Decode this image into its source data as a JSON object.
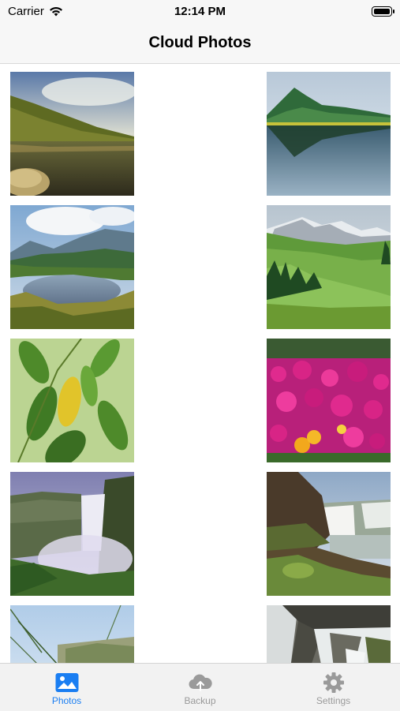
{
  "status_bar": {
    "carrier": "Carrier",
    "time": "12:14 PM"
  },
  "nav": {
    "title": "Cloud Photos"
  },
  "photos": [
    {
      "subject": "mountain lake at sunset"
    },
    {
      "subject": "green mountain reflected in lake"
    },
    {
      "subject": "alpine lake under clouds"
    },
    {
      "subject": "green meadow with snowy peaks"
    },
    {
      "subject": "green leaves with yellow leaf"
    },
    {
      "subject": "pink flowers with yellow blossoms"
    },
    {
      "subject": "misty waterfall"
    },
    {
      "subject": "waterfall with mossy rocks"
    },
    {
      "subject": "grass against sky"
    },
    {
      "subject": "cascading water over rocks"
    }
  ],
  "tabs": [
    {
      "label": "Photos",
      "icon": "photo-icon",
      "active": true
    },
    {
      "label": "Backup",
      "icon": "cloud-upload-icon",
      "active": false
    },
    {
      "label": "Settings",
      "icon": "gear-icon",
      "active": false
    }
  ],
  "colors": {
    "accent": "#1a7ef2",
    "inactive": "#9a9a9a"
  }
}
